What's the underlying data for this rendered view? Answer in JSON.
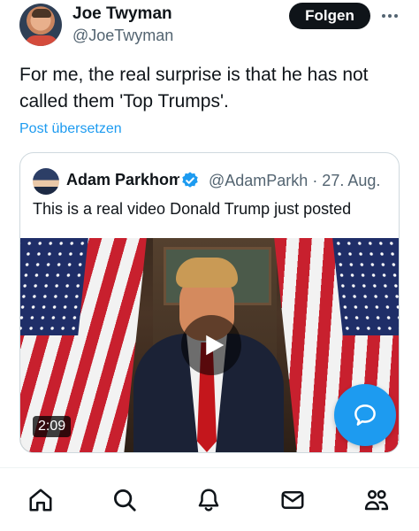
{
  "author": {
    "name": "Joe Twyman",
    "handle": "@JoeTwyman",
    "follow_label": "Folgen"
  },
  "tweet": {
    "text": "For me, the real surprise is that he has not called them 'Top Trumps'.",
    "translate_label": "Post übersetzen"
  },
  "quoted": {
    "name": "Adam Parkhomenko",
    "verified": true,
    "handle_date": "@AdamParkh · 27. Aug.",
    "text": "This is a real video Donald Trump just posted",
    "video": {
      "duration": "2:09"
    }
  },
  "tabbar": {
    "items": [
      "home-icon",
      "search-icon",
      "notifications-icon",
      "messages-icon",
      "communities-icon"
    ]
  },
  "colors": {
    "accent": "#1d9bf0",
    "text": "#0f1419",
    "muted": "#536471"
  }
}
